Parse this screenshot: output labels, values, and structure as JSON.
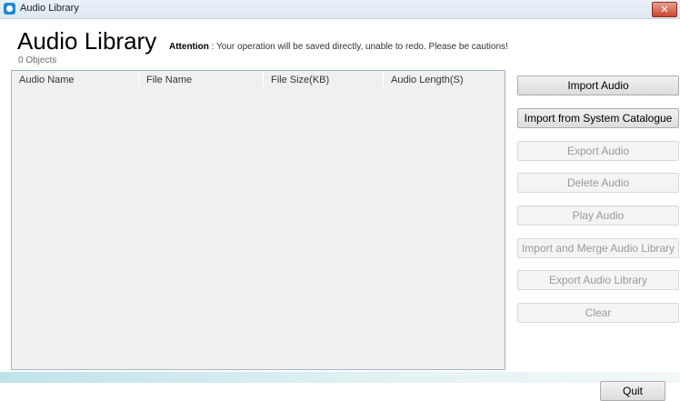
{
  "window": {
    "title": "Audio Library",
    "close_glyph": "✕"
  },
  "header": {
    "title": "Audio Library",
    "object_count": "0 Objects",
    "attention_label": "Attention",
    "attention_text": " : Your operation will be saved directly, unable to redo. Please be cautions!"
  },
  "table": {
    "columns": [
      "Audio Name",
      "File Name",
      "File Size(KB)",
      "Audio Length(S)"
    ],
    "rows": []
  },
  "actions": [
    {
      "label": "Import Audio",
      "enabled": true
    },
    {
      "label": "Import from System Catalogue",
      "enabled": true
    },
    {
      "label": "Export Audio",
      "enabled": false
    },
    {
      "label": "Delete Audio",
      "enabled": false
    },
    {
      "label": "Play Audio",
      "enabled": false
    },
    {
      "label": "Import and Merge Audio Library",
      "enabled": false
    },
    {
      "label": "Export Audio Library",
      "enabled": false
    },
    {
      "label": "Clear",
      "enabled": false
    }
  ],
  "footer": {
    "quit_label": "Quit"
  },
  "icons": {
    "app": "audio-library-app-icon",
    "close": "close-icon"
  }
}
